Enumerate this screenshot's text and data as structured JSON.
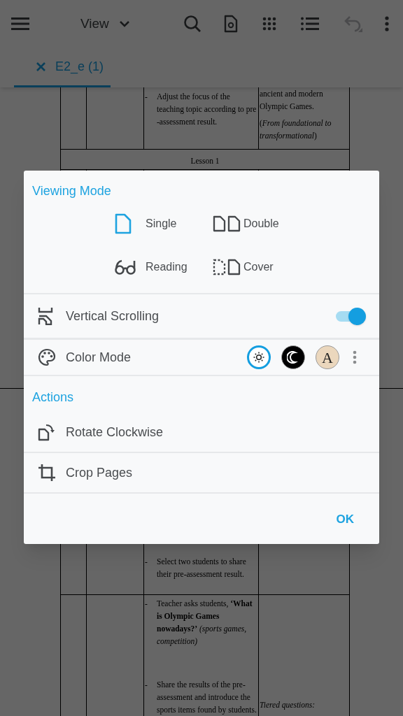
{
  "toolbar": {
    "view_label": "View"
  },
  "tabs": [
    {
      "label": "E2_e (1)",
      "selected": true
    }
  ],
  "document": {
    "rows": [
      {
        "kind": "content",
        "bullets": [
          {
            "marker": "-",
            "text": "Adjust the focus of the teaching topic according to pre -assessment result."
          }
        ],
        "notes": [
          "ancient and modern Olympic Games.",
          "(*From foundational to transformational*)"
        ]
      },
      {
        "kind": "heading",
        "text": "Lesson 1"
      },
      {
        "kind": "content",
        "bullets": [
          {
            "marker": "-",
            "text": "Select two students to share their pre-assessment result."
          }
        ]
      },
      {
        "kind": "content",
        "bullets": [
          {
            "marker": "-",
            "text": "Teacher asks students, **‘What is Olympic Games nowadays?’** *(sports games, competition)*"
          },
          {
            "marker": "-",
            "text": "Share the results of the pre-assessment and introduce the sports items found by students."
          }
        ],
        "notes": [
          "Tiered questions:"
        ]
      }
    ]
  },
  "dialog": {
    "viewing_mode": {
      "title": "Viewing Mode",
      "options": [
        {
          "kind": "single",
          "label": "Single",
          "selected": true
        },
        {
          "kind": "double",
          "label": "Double",
          "selected": false
        },
        {
          "kind": "reading",
          "label": "Reading",
          "selected": false
        },
        {
          "kind": "cover",
          "label": "Cover",
          "selected": false
        }
      ]
    },
    "vertical_scrolling": {
      "label": "Vertical Scrolling",
      "on": true
    },
    "color_mode": {
      "label": "Color Mode",
      "options": [
        {
          "kind": "light",
          "selected": true
        },
        {
          "kind": "dark",
          "selected": false
        },
        {
          "kind": "sepia",
          "label": "A",
          "selected": false
        }
      ]
    },
    "actions": {
      "title": "Actions",
      "items": [
        {
          "kind": "rotate",
          "label": "Rotate Clockwise"
        },
        {
          "kind": "crop",
          "label": "Crop Pages"
        }
      ]
    },
    "ok_button": "OK"
  }
}
